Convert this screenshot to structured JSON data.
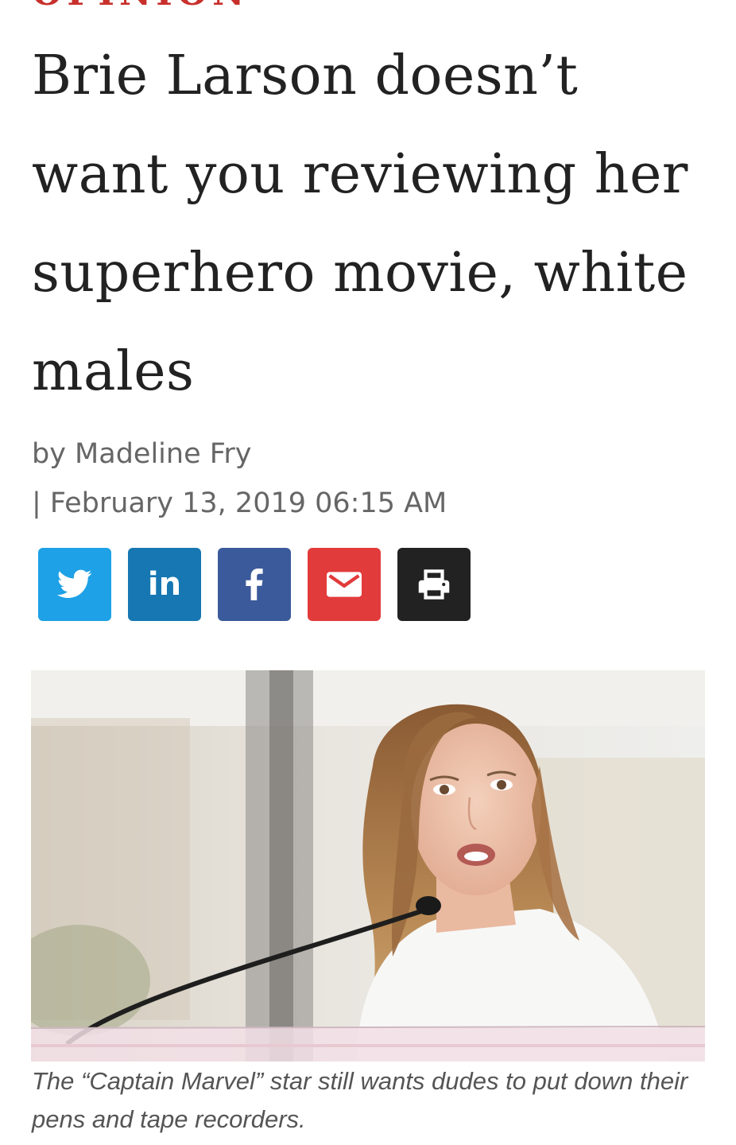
{
  "article": {
    "section": "Opinion",
    "headline": "Brie Larson doesn’t want you reviewing her superhero movie, white males",
    "byline": "by Madeline Fry",
    "dateline": "| February 13, 2019 06:15 AM",
    "caption": "The “Captain Marvel” star still wants dudes to put down their pens and tape recorders."
  },
  "share": {
    "buttons": [
      {
        "icon": "twitter-icon",
        "color": "#1ea1e6"
      },
      {
        "icon": "linkedin-icon",
        "label": "in",
        "color": "#1677b2"
      },
      {
        "icon": "facebook-icon",
        "color": "#3b5a9b"
      },
      {
        "icon": "email-icon",
        "color": "#e23b3b"
      },
      {
        "icon": "print-icon",
        "color": "#222222"
      }
    ]
  },
  "colors": {
    "accent": "#c8302c",
    "headline": "#222222",
    "meta": "#666666"
  }
}
